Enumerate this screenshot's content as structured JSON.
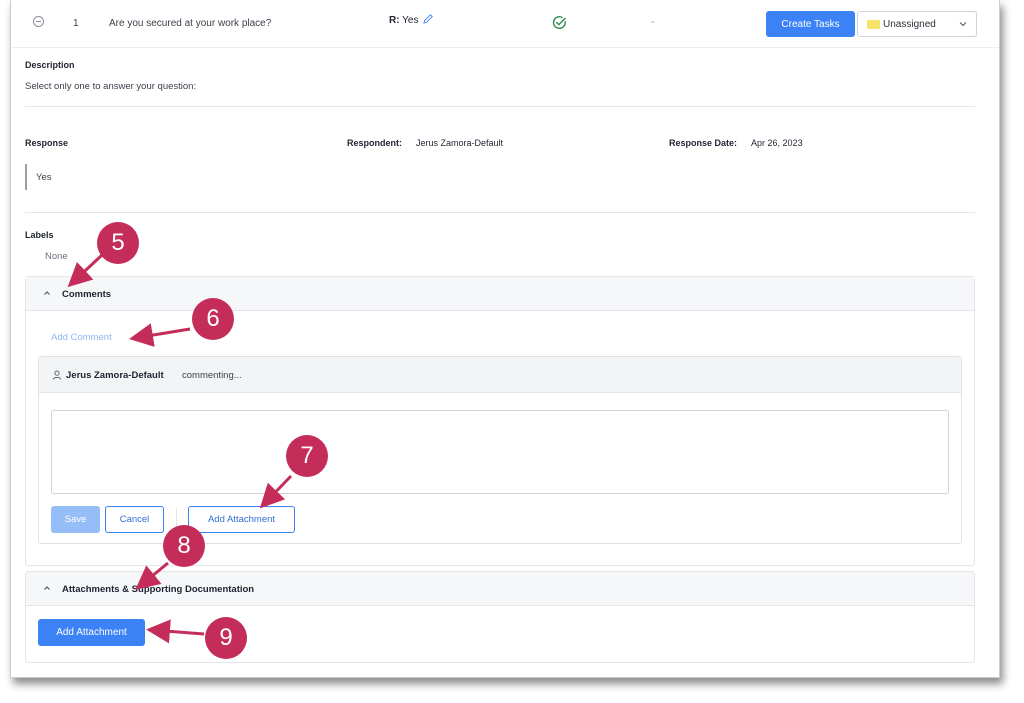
{
  "question": {
    "number": "1",
    "text": "Are you secured at your work place?",
    "response_prefix": "R:",
    "response_value": "Yes",
    "status_dash": "-",
    "create_tasks_label": "Create Tasks",
    "assignee_value": "Unassigned",
    "assignee_color": "#f6e36a"
  },
  "description": {
    "heading": "Description",
    "text": "Select only one to answer your question:"
  },
  "response": {
    "heading": "Response",
    "respondent_label": "Respondent:",
    "respondent_value": "Jerus Zamora-Default",
    "date_label": "Response Date:",
    "date_value": "Apr 26, 2023",
    "value": "Yes"
  },
  "labels": {
    "heading": "Labels",
    "value": "None"
  },
  "comments": {
    "title": "Comments",
    "add_comment_label": "Add Comment",
    "author": "Jerus Zamora-Default",
    "status": "commenting...",
    "textarea_value": "",
    "save_label": "Save",
    "cancel_label": "Cancel",
    "add_attachment_label": "Add Attachment"
  },
  "attachments": {
    "title": "Attachments & Supporting Documentation",
    "add_attachment_label": "Add Attachment"
  },
  "callouts": [
    "5",
    "6",
    "7",
    "8",
    "9"
  ],
  "colors": {
    "primary": "#3b82f6",
    "callout": "#c42d5a",
    "success": "#2e8b4a"
  }
}
